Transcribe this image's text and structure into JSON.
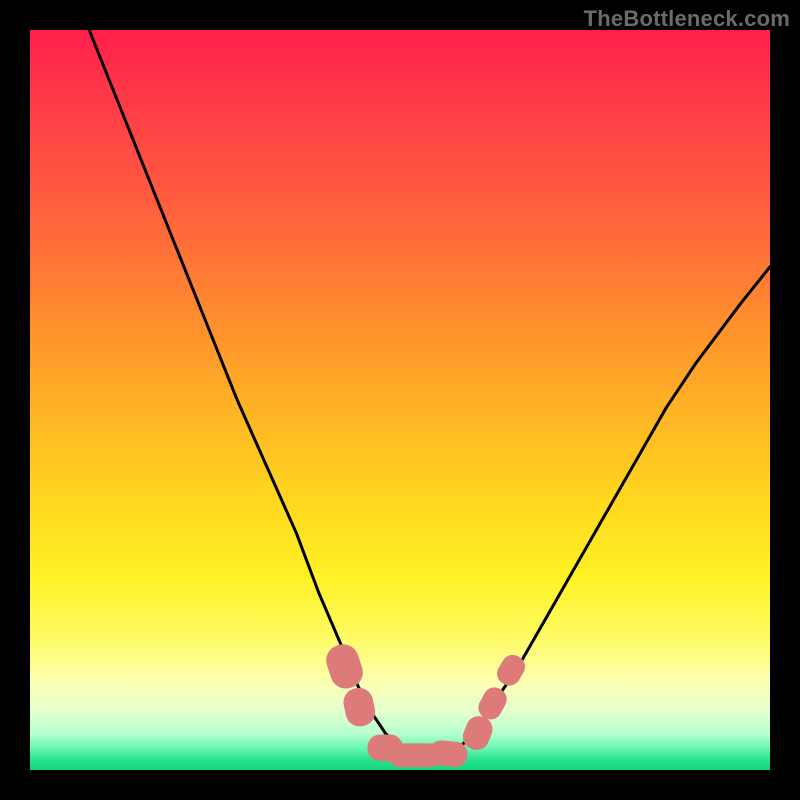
{
  "watermark": {
    "text": "TheBottleneck.com"
  },
  "chart_data": {
    "type": "line",
    "title": "",
    "xlabel": "",
    "ylabel": "",
    "xlim": [
      0,
      100
    ],
    "ylim": [
      0,
      100
    ],
    "series": [
      {
        "name": "curve",
        "x": [
          8,
          12,
          16,
          20,
          24,
          28,
          32,
          36,
          39,
          42,
          44,
          46,
          48,
          50,
          52,
          54,
          56,
          58,
          60,
          62,
          66,
          70,
          74,
          78,
          82,
          86,
          90,
          96,
          100
        ],
        "values": [
          100,
          90,
          80,
          70,
          60,
          50,
          41,
          32,
          24,
          17,
          12,
          8,
          5,
          3,
          2,
          2,
          2,
          3,
          5,
          8,
          14,
          21,
          28,
          35,
          42,
          49,
          55,
          63,
          68
        ]
      }
    ],
    "markers": [
      {
        "type": "rounded-blob",
        "cx": 42.5,
        "cy": 14,
        "rx": 2.2,
        "ry": 3.0,
        "rot": -18
      },
      {
        "type": "rounded-blob",
        "cx": 44.5,
        "cy": 8.5,
        "rx": 2.0,
        "ry": 2.6,
        "rot": -12
      },
      {
        "type": "rounded-blob",
        "cx": 48.0,
        "cy": 3.0,
        "rx": 2.4,
        "ry": 1.8,
        "rot": 0
      },
      {
        "type": "rounded-blob",
        "cx": 52.0,
        "cy": 2.0,
        "rx": 3.6,
        "ry": 1.6,
        "rot": 0
      },
      {
        "type": "rounded-blob",
        "cx": 56.5,
        "cy": 2.2,
        "rx": 2.6,
        "ry": 1.7,
        "rot": 5
      },
      {
        "type": "rounded-blob",
        "cx": 60.5,
        "cy": 5.0,
        "rx": 1.8,
        "ry": 2.3,
        "rot": 22
      },
      {
        "type": "rounded-blob",
        "cx": 62.5,
        "cy": 9.0,
        "rx": 1.6,
        "ry": 2.2,
        "rot": 28
      },
      {
        "type": "rounded-blob",
        "cx": 65.0,
        "cy": 13.5,
        "rx": 1.6,
        "ry": 2.1,
        "rot": 30
      }
    ],
    "colors": {
      "curve_stroke": "#000000",
      "marker_fill": "#dc7b79",
      "frame": "#000000"
    }
  }
}
